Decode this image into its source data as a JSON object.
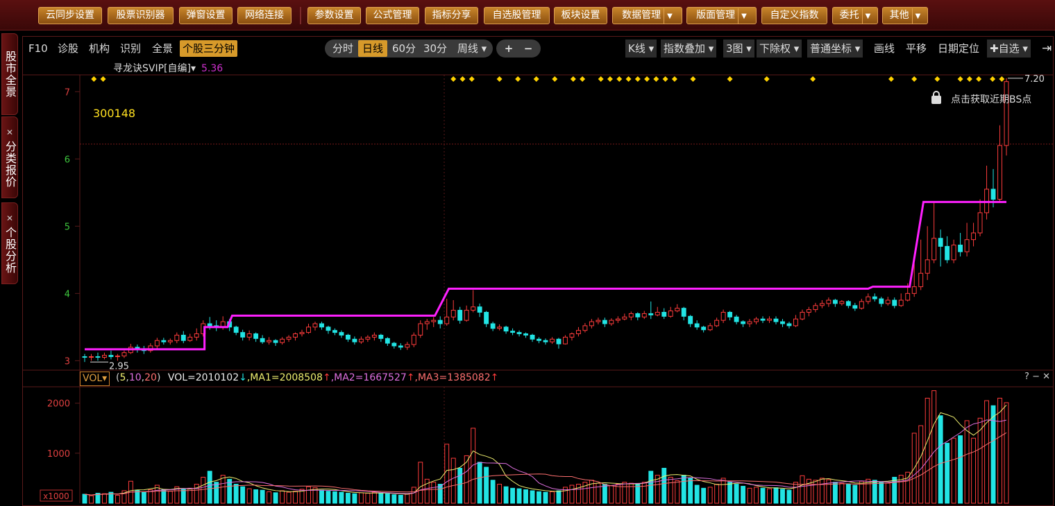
{
  "toolbar": {
    "buttons": [
      {
        "label": "云同步设置"
      },
      {
        "label": "股票识别器"
      },
      {
        "label": "弹窗设置"
      },
      {
        "label": "网络连接"
      },
      {
        "label": "参数设置"
      },
      {
        "label": "公式管理"
      },
      {
        "label": "指标分享"
      },
      {
        "label": "自选股管理"
      },
      {
        "label": "板块设置"
      },
      {
        "label": "数据管理"
      },
      {
        "label": "版面管理"
      },
      {
        "label": "自定义指数"
      },
      {
        "label": "委托"
      },
      {
        "label": "其他"
      }
    ],
    "dropdown_arrow": "▼"
  },
  "sidebar": {
    "tabs": [
      {
        "label": "股市全景"
      },
      {
        "label": "分类报价"
      },
      {
        "label": "个股分析"
      }
    ],
    "close_glyph": "✕"
  },
  "subbar": {
    "left": [
      "F10",
      "诊股",
      "机构",
      "识别",
      "全景",
      "个股三分钟"
    ],
    "active_left": "个股三分钟",
    "periods": [
      "分时",
      "日线",
      "60分",
      "30分",
      "周线 ▾"
    ],
    "active_period": "日线",
    "zoom": [
      "+",
      "−"
    ],
    "right": [
      "K线 ▾",
      "指数叠加 ▾",
      "3图 ▾",
      "下除权 ▾",
      "普通坐标 ▾",
      "画线",
      "平移",
      "日期定位",
      "✚自选 ▾"
    ],
    "collapse_icon": "⇥"
  },
  "indicator": {
    "name": "寻龙诀SVIP[自编]",
    "value": "5.36"
  },
  "stock_code": "300148",
  "bs_hint": "点击获取近期BS点",
  "volume_panel": {
    "selector": "VOL▾",
    "params_prefix": "(",
    "p1": "5",
    "p2": "10",
    "p3": "20",
    "params_suffix": ")",
    "vol_text": "VOL=2010102",
    "vol_arrow": "↓",
    "ma1_text": ",MA1=2008508",
    "ma1_arrow": "↑",
    "ma2_text": ",MA2=1667527",
    "ma2_arrow": "↑",
    "ma3_text": ",MA3=1385082",
    "ma3_arrow": "↑",
    "controls": "? − ✕",
    "unit": "x1000"
  },
  "colors": {
    "up": "#ff3c3c",
    "down": "#22e4e4",
    "indicator": "#ff20ff",
    "signal": "#ffd200",
    "ma1": "#f0f070",
    "ma2": "#e070e0",
    "ma3": "#ff7070",
    "grid": "#5a1a1a"
  },
  "chart_data": {
    "type": "candlestick",
    "price_axis": {
      "ticks": [
        3,
        4,
        5,
        6,
        7
      ],
      "range": [
        2.88,
        7.25
      ]
    },
    "volume_axis": {
      "ticks": [
        1000,
        2000
      ],
      "range": [
        0,
        2300
      ],
      "unit": "x1000"
    },
    "high_label": "7.20",
    "low_label": "2.95",
    "indicator_steps": [
      {
        "from": 0,
        "to": 0.13,
        "value": 3.17
      },
      {
        "from": 0.13,
        "to": 0.155,
        "value": 3.5
      },
      {
        "from": 0.16,
        "to": 0.38,
        "value": 3.67
      },
      {
        "from": 0.395,
        "to": 0.85,
        "value": 4.07
      },
      {
        "from": 0.855,
        "to": 0.895,
        "value": 4.1
      },
      {
        "from": 0.91,
        "to": 1.0,
        "value": 5.36
      }
    ],
    "signal_positions": [
      0.01,
      0.02,
      0.4,
      0.41,
      0.42,
      0.45,
      0.47,
      0.49,
      0.51,
      0.53,
      0.54,
      0.56,
      0.57,
      0.58,
      0.59,
      0.6,
      0.61,
      0.62,
      0.63,
      0.64,
      0.66,
      0.7,
      0.74,
      0.79,
      0.875,
      0.9,
      0.925,
      0.95,
      0.96,
      0.97,
      0.985,
      0.995
    ],
    "candles": [
      [
        3.06,
        3.05,
        3.1,
        2.98,
        180
      ],
      [
        3.05,
        3.06,
        3.1,
        3.0,
        150
      ],
      [
        3.06,
        3.05,
        3.12,
        3.0,
        200
      ],
      [
        3.05,
        3.08,
        3.12,
        3.02,
        190
      ],
      [
        3.08,
        3.06,
        3.15,
        3.02,
        220
      ],
      [
        3.06,
        3.07,
        3.1,
        3.0,
        160
      ],
      [
        3.07,
        3.12,
        3.15,
        3.04,
        250
      ],
      [
        3.12,
        3.2,
        3.25,
        3.1,
        440
      ],
      [
        3.2,
        3.17,
        3.24,
        3.12,
        260
      ],
      [
        3.17,
        3.15,
        3.22,
        3.1,
        230
      ],
      [
        3.15,
        3.22,
        3.26,
        3.12,
        270
      ],
      [
        3.22,
        3.3,
        3.34,
        3.18,
        360
      ],
      [
        3.3,
        3.28,
        3.34,
        3.24,
        270
      ],
      [
        3.28,
        3.3,
        3.33,
        3.24,
        240
      ],
      [
        3.3,
        3.38,
        3.42,
        3.26,
        330
      ],
      [
        3.38,
        3.3,
        3.44,
        3.26,
        280
      ],
      [
        3.3,
        3.35,
        3.4,
        3.28,
        300
      ],
      [
        3.35,
        3.4,
        3.48,
        3.3,
        380
      ],
      [
        3.4,
        3.55,
        3.6,
        3.36,
        520
      ],
      [
        3.55,
        3.52,
        3.65,
        3.46,
        640
      ],
      [
        3.52,
        3.5,
        3.6,
        3.44,
        420
      ],
      [
        3.5,
        3.58,
        3.66,
        3.46,
        560
      ],
      [
        3.58,
        3.5,
        3.62,
        3.44,
        480
      ],
      [
        3.5,
        3.42,
        3.52,
        3.38,
        380
      ],
      [
        3.42,
        3.35,
        3.46,
        3.3,
        330
      ],
      [
        3.35,
        3.4,
        3.45,
        3.3,
        290
      ],
      [
        3.4,
        3.33,
        3.42,
        3.28,
        270
      ],
      [
        3.33,
        3.28,
        3.38,
        3.25,
        260
      ],
      [
        3.28,
        3.3,
        3.35,
        3.24,
        230
      ],
      [
        3.3,
        3.27,
        3.32,
        3.22,
        210
      ],
      [
        3.27,
        3.32,
        3.35,
        3.24,
        250
      ],
      [
        3.32,
        3.35,
        3.38,
        3.28,
        220
      ],
      [
        3.35,
        3.4,
        3.42,
        3.3,
        240
      ],
      [
        3.4,
        3.42,
        3.46,
        3.36,
        280
      ],
      [
        3.42,
        3.5,
        3.55,
        3.4,
        330
      ],
      [
        3.5,
        3.55,
        3.58,
        3.45,
        310
      ],
      [
        3.55,
        3.5,
        3.58,
        3.46,
        260
      ],
      [
        3.5,
        3.45,
        3.52,
        3.4,
        240
      ],
      [
        3.45,
        3.42,
        3.48,
        3.38,
        230
      ],
      [
        3.42,
        3.38,
        3.45,
        3.34,
        220
      ],
      [
        3.38,
        3.32,
        3.4,
        3.28,
        200
      ],
      [
        3.32,
        3.28,
        3.36,
        3.24,
        190
      ],
      [
        3.28,
        3.32,
        3.36,
        3.25,
        210
      ],
      [
        3.32,
        3.35,
        3.38,
        3.28,
        200
      ],
      [
        3.35,
        3.38,
        3.42,
        3.3,
        220
      ],
      [
        3.38,
        3.33,
        3.4,
        3.28,
        200
      ],
      [
        3.33,
        3.26,
        3.35,
        3.22,
        190
      ],
      [
        3.26,
        3.22,
        3.28,
        3.18,
        170
      ],
      [
        3.22,
        3.2,
        3.26,
        3.16,
        160
      ],
      [
        3.2,
        3.24,
        3.28,
        3.16,
        180
      ],
      [
        3.24,
        3.38,
        3.42,
        3.2,
        320
      ],
      [
        3.38,
        3.55,
        3.6,
        3.34,
        820
      ],
      [
        3.55,
        3.58,
        3.62,
        3.46,
        480
      ],
      [
        3.58,
        3.6,
        3.65,
        3.5,
        420
      ],
      [
        3.6,
        3.55,
        3.66,
        3.48,
        380
      ],
      [
        3.55,
        3.65,
        3.92,
        3.52,
        1180
      ],
      [
        3.65,
        3.75,
        3.9,
        3.6,
        900
      ],
      [
        3.75,
        3.6,
        3.8,
        3.55,
        700
      ],
      [
        3.6,
        3.75,
        3.82,
        3.58,
        950
      ],
      [
        3.75,
        3.8,
        4.05,
        3.72,
        1500
      ],
      [
        3.8,
        3.72,
        3.85,
        3.65,
        820
      ],
      [
        3.72,
        3.55,
        3.74,
        3.5,
        720
      ],
      [
        3.55,
        3.48,
        3.58,
        3.44,
        460
      ],
      [
        3.48,
        3.5,
        3.54,
        3.45,
        380
      ],
      [
        3.5,
        3.44,
        3.52,
        3.4,
        330
      ],
      [
        3.44,
        3.42,
        3.48,
        3.38,
        300
      ],
      [
        3.42,
        3.4,
        3.45,
        3.36,
        290
      ],
      [
        3.4,
        3.38,
        3.42,
        3.34,
        270
      ],
      [
        3.38,
        3.32,
        3.4,
        3.28,
        250
      ],
      [
        3.32,
        3.3,
        3.35,
        3.26,
        230
      ],
      [
        3.3,
        3.28,
        3.33,
        3.24,
        220
      ],
      [
        3.28,
        3.32,
        3.35,
        3.25,
        230
      ],
      [
        3.32,
        3.25,
        3.34,
        3.18,
        250
      ],
      [
        3.25,
        3.35,
        3.38,
        3.24,
        320
      ],
      [
        3.35,
        3.4,
        3.42,
        3.3,
        360
      ],
      [
        3.4,
        3.45,
        3.5,
        3.36,
        380
      ],
      [
        3.45,
        3.52,
        3.56,
        3.42,
        420
      ],
      [
        3.52,
        3.58,
        3.62,
        3.48,
        460
      ],
      [
        3.58,
        3.6,
        3.64,
        3.54,
        400
      ],
      [
        3.6,
        3.55,
        3.64,
        3.5,
        380
      ],
      [
        3.55,
        3.6,
        3.63,
        3.52,
        350
      ],
      [
        3.6,
        3.62,
        3.66,
        3.56,
        380
      ],
      [
        3.62,
        3.65,
        3.7,
        3.6,
        420
      ],
      [
        3.65,
        3.7,
        3.73,
        3.6,
        400
      ],
      [
        3.7,
        3.65,
        3.72,
        3.6,
        380
      ],
      [
        3.65,
        3.7,
        3.74,
        3.62,
        420
      ],
      [
        3.7,
        3.68,
        3.88,
        3.62,
        640
      ],
      [
        3.68,
        3.72,
        3.8,
        3.66,
        560
      ],
      [
        3.72,
        3.66,
        3.78,
        3.62,
        700
      ],
      [
        3.66,
        3.74,
        3.8,
        3.64,
        520
      ],
      [
        3.74,
        3.78,
        3.84,
        3.72,
        450
      ],
      [
        3.78,
        3.66,
        3.8,
        3.6,
        560
      ],
      [
        3.66,
        3.55,
        3.68,
        3.5,
        500
      ],
      [
        3.55,
        3.5,
        3.6,
        3.46,
        360
      ],
      [
        3.5,
        3.46,
        3.52,
        3.42,
        300
      ],
      [
        3.46,
        3.52,
        3.56,
        3.44,
        320
      ],
      [
        3.52,
        3.6,
        3.64,
        3.5,
        380
      ],
      [
        3.6,
        3.72,
        3.76,
        3.56,
        500
      ],
      [
        3.72,
        3.65,
        3.74,
        3.6,
        420
      ],
      [
        3.65,
        3.58,
        3.68,
        3.54,
        380
      ],
      [
        3.58,
        3.55,
        3.6,
        3.5,
        340
      ],
      [
        3.55,
        3.58,
        3.62,
        3.5,
        300
      ],
      [
        3.58,
        3.62,
        3.65,
        3.54,
        320
      ],
      [
        3.62,
        3.6,
        3.66,
        3.56,
        300
      ],
      [
        3.6,
        3.62,
        3.66,
        3.56,
        290
      ],
      [
        3.62,
        3.58,
        3.66,
        3.54,
        310
      ],
      [
        3.58,
        3.55,
        3.62,
        3.5,
        280
      ],
      [
        3.55,
        3.52,
        3.58,
        3.48,
        260
      ],
      [
        3.52,
        3.62,
        3.68,
        3.5,
        420
      ],
      [
        3.62,
        3.72,
        3.76,
        3.6,
        550
      ],
      [
        3.72,
        3.76,
        3.8,
        3.66,
        480
      ],
      [
        3.76,
        3.82,
        3.86,
        3.72,
        460
      ],
      [
        3.82,
        3.85,
        3.9,
        3.78,
        500
      ],
      [
        3.85,
        3.9,
        3.94,
        3.8,
        470
      ],
      [
        3.9,
        3.85,
        3.92,
        3.8,
        420
      ],
      [
        3.85,
        3.88,
        3.9,
        3.82,
        400
      ],
      [
        3.88,
        3.82,
        3.9,
        3.78,
        380
      ],
      [
        3.82,
        3.78,
        3.86,
        3.74,
        360
      ],
      [
        3.78,
        3.88,
        3.92,
        3.76,
        440
      ],
      [
        3.88,
        3.95,
        4.0,
        3.84,
        480
      ],
      [
        3.95,
        3.92,
        4.0,
        3.88,
        460
      ],
      [
        3.92,
        3.85,
        3.95,
        3.8,
        420
      ],
      [
        3.85,
        3.9,
        3.95,
        3.82,
        400
      ],
      [
        3.9,
        3.82,
        3.94,
        3.78,
        520
      ],
      [
        3.82,
        3.9,
        4.0,
        3.8,
        560
      ],
      [
        3.9,
        4.0,
        4.15,
        3.88,
        620
      ],
      [
        4.0,
        4.1,
        4.45,
        3.95,
        1400
      ],
      [
        4.1,
        4.3,
        4.8,
        4.05,
        1550
      ],
      [
        4.3,
        4.5,
        5.0,
        4.2,
        2100
      ],
      [
        4.5,
        4.82,
        5.35,
        4.45,
        2250
      ],
      [
        4.82,
        4.7,
        4.95,
        4.4,
        1750
      ],
      [
        4.7,
        4.5,
        4.85,
        4.45,
        1200
      ],
      [
        4.5,
        4.72,
        4.8,
        4.45,
        1300
      ],
      [
        4.72,
        4.62,
        4.9,
        4.55,
        1350
      ],
      [
        4.62,
        4.8,
        5.05,
        4.55,
        1650
      ],
      [
        4.8,
        4.9,
        5.05,
        4.7,
        1300
      ],
      [
        4.9,
        5.2,
        5.4,
        4.85,
        1700
      ],
      [
        5.2,
        5.55,
        5.9,
        5.1,
        2050
      ],
      [
        5.55,
        5.4,
        5.85,
        5.28,
        1950
      ],
      [
        5.4,
        6.2,
        6.5,
        5.35,
        2100
      ],
      [
        6.2,
        7.15,
        7.2,
        6.05,
        2010
      ]
    ]
  }
}
